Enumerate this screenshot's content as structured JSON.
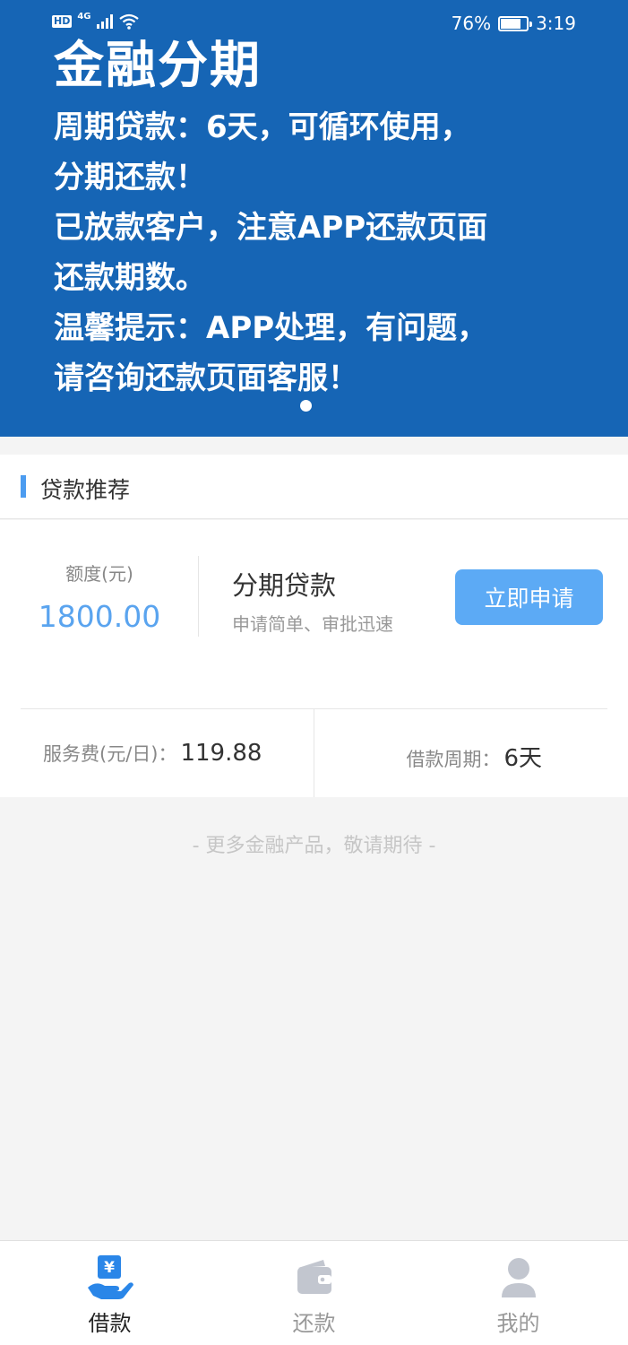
{
  "status_bar": {
    "hd": "HD",
    "network": "4G",
    "battery_percent": "76%",
    "time": "3:19"
  },
  "banner": {
    "title": "金融分期",
    "lines": [
      "周期贷款：6天，可循环使用，",
      "分期还款！",
      "已放款客户，注意APP还款页面",
      "还款期数。",
      "温馨提示：APP处理，有问题，",
      "请咨询还款页面客服！"
    ]
  },
  "section": {
    "title": "贷款推荐"
  },
  "product": {
    "quota_label": "额度(元)",
    "quota_value": "1800.00",
    "name": "分期贷款",
    "description": "申请简单、审批迅速",
    "apply_label": "立即申请",
    "fee_label": "服务费(元/日)：",
    "fee_value": "119.88",
    "term_label": "借款周期：",
    "term_value": "6天"
  },
  "footer_note": "- 更多金融产品，敬请期待 -",
  "tabbar": {
    "tabs": [
      {
        "label": "借款",
        "icon": "loan-hand-yen-icon",
        "active": true
      },
      {
        "label": "还款",
        "icon": "wallet-icon",
        "active": false
      },
      {
        "label": "我的",
        "icon": "user-icon",
        "active": false
      }
    ]
  },
  "colors": {
    "banner": "#1665b5",
    "accent": "#5caaf5",
    "quota": "#5aa4ef",
    "active_icon": "#2a86e8",
    "inactive_icon": "#c2c6cf"
  }
}
